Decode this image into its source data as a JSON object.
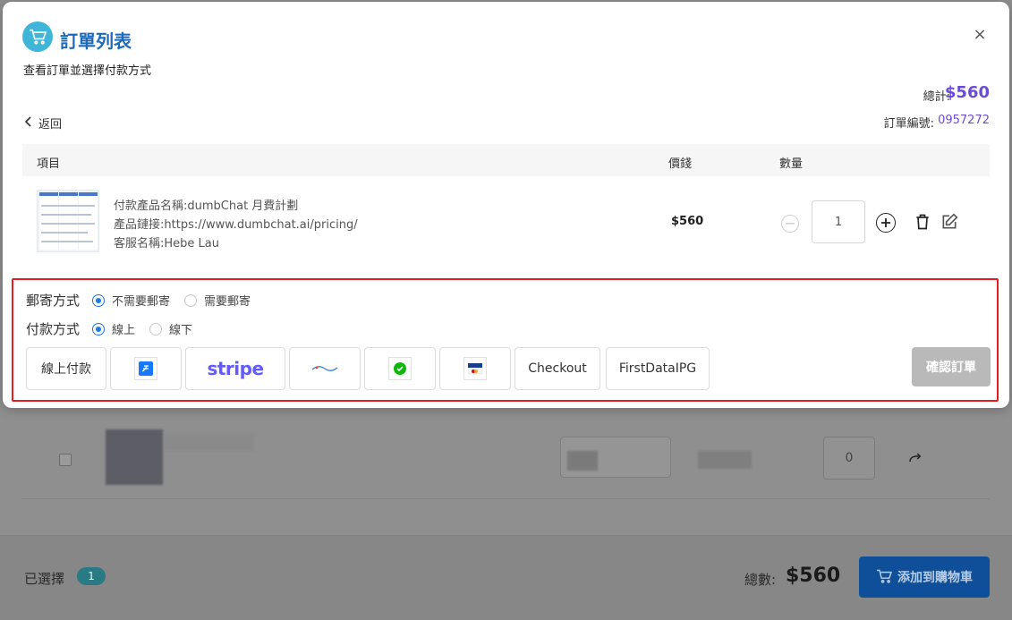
{
  "modal": {
    "title": "訂單列表",
    "subtitle": "查看訂單並選擇付款方式",
    "close_label": "×",
    "total_label": "總計:",
    "total_value": "$560",
    "order_no_label": "訂單編號:",
    "order_no_value": "0957272",
    "back_label": "返回"
  },
  "table": {
    "headers": {
      "item": "項目",
      "price": "價錢",
      "qty": "數量"
    },
    "rows": [
      {
        "product_name": "付款產品名稱:dumbChat 月費計劃",
        "product_link": "產品鏈接:https://www.dumbchat.ai/pricing/",
        "agent_name": "客服名稱:Hebe Lau",
        "price": "$560",
        "qty": "1"
      }
    ]
  },
  "shipping": {
    "title": "郵寄方式",
    "options": [
      "不需要郵寄",
      "需要郵寄"
    ],
    "selected": 0
  },
  "payment": {
    "title": "付款方式",
    "options": [
      "線上",
      "線下"
    ],
    "selected": 0,
    "methods": {
      "online_label": "線上付款",
      "stripe_label": "stripe",
      "checkout_label": "Checkout",
      "firstdata_label": "FirstDataIPG"
    },
    "confirm_label": "確認訂單"
  },
  "background": {
    "qty_value": "0",
    "selected_label": "已選擇",
    "selected_count": "1",
    "total_label": "總數:",
    "total_value": "$560",
    "add_cart_label": "添加到購物車"
  },
  "colors": {
    "title_blue": "#1e6ab9",
    "accent_purple": "#6a4bd8",
    "radio_blue": "#1e7be0",
    "highlight_red": "#e02020",
    "stripe_purple": "#635bff"
  }
}
